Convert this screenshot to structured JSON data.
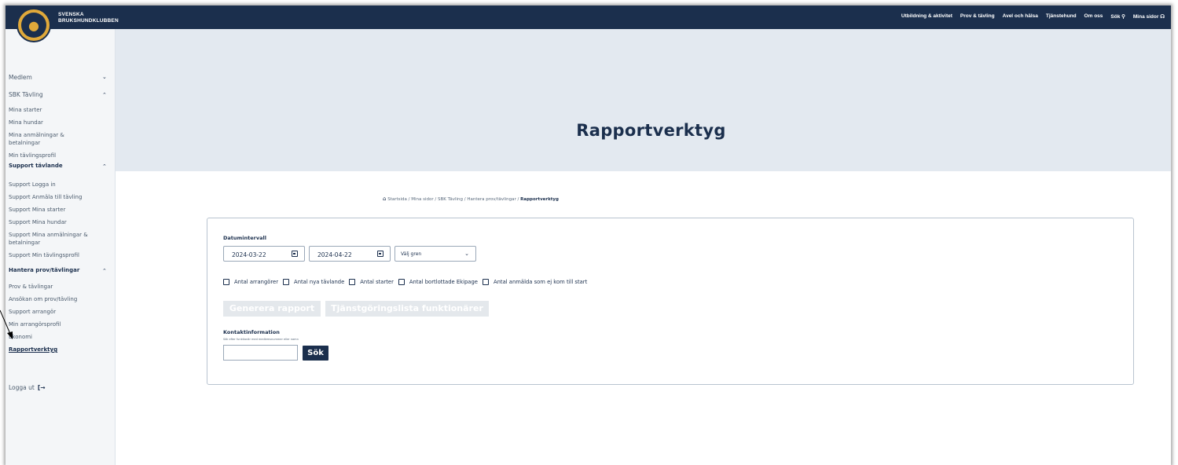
{
  "brand": {
    "line1": "SVENSKA",
    "line2": "BRUKSHUNDKLUBBEN"
  },
  "nav": [
    "Utbildning & aktivitet",
    "Prov & tävling",
    "Avel och hälsa",
    "Tjänstehund",
    "Om oss",
    "Sök",
    "Mina sidor"
  ],
  "sidebar": {
    "medlem": "Medlem",
    "sbk_tavling": "SBK Tävling",
    "tavling_items": [
      "Mina starter",
      "Mina hundar",
      "Mina anmälningar &",
      "betalningar",
      "Min tävlingsprofil"
    ],
    "support_head": "Support tävlande",
    "support_items": [
      "Support Logga in",
      "Support Anmäla till tävling",
      "Support Mina starter",
      "Support Mina hundar",
      "Support Mina anmälningar &",
      "betalningar",
      "Support Min tävlingsprofil"
    ],
    "hantera_head": "Hantera prov/tävlingar",
    "hantera_items": [
      "Prov & tävlingar",
      "Ansökan om prov/tävling",
      "Support arrangör",
      "Min arrangörsprofil",
      "Ekonomi"
    ],
    "active": "Rapportverktyg",
    "logout": "Logga ut"
  },
  "hero": {
    "title": "Rapportverktyg"
  },
  "breadcrumb": {
    "trail": "Startsida / Mina sidor / SBK Tävling / Hantera prov/tävlingar / ",
    "current": "Rapportverktyg"
  },
  "form": {
    "date_label": "Datumintervall",
    "date_from": "2024-03-22",
    "date_to": "2024-04-22",
    "select_placeholder": "Välj gren",
    "checkboxes": [
      "Antal arrangörer",
      "Antal nya tävlande",
      "Antal starter",
      "Antal bortlottade Ekipage",
      "Antal anmälda som ej kom till start"
    ],
    "btn_generate": "Generera rapport",
    "btn_tjanst": "Tjänstgöringslista funktionärer",
    "contact_label": "Kontaktinformation",
    "contact_hint": "Sök efter funktionär med medlemsnummer eller namn",
    "search_btn": "Sök"
  }
}
